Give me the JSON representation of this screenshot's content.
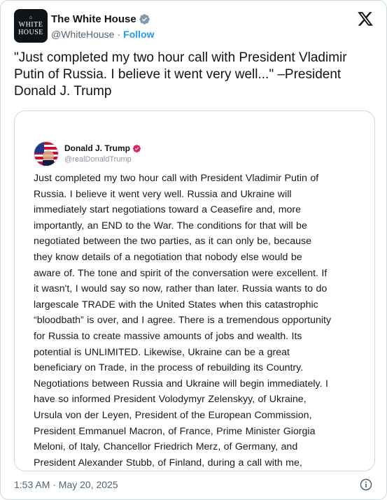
{
  "author": {
    "display_name": "The White House",
    "handle": "@WhiteHouse",
    "separator": "·",
    "follow_label": "Follow",
    "avatar_text_1": "WHITE",
    "avatar_text_2": "HOUSE"
  },
  "post": {
    "text": "\"Just completed my two hour call with President Vladimir Putin of Russia. I believe it went very well...\" –President Donald J. Trump"
  },
  "quoted": {
    "display_name": "Donald J. Trump",
    "handle": "@realDonaldTrump",
    "lines": [
      "Just completed my two hour call with President Vladimir Putin of",
      "Russia. I believe it went very well. Russia and Ukraine will",
      "immediately start negotiations toward a Ceasefire and, more",
      "importantly, an END to the War. The conditions for that will be",
      "negotiated between the two parties, as it can only be, because",
      "they know details of a negotiation that nobody else would be",
      "aware of. The tone and spirit of the conversation were excellent. If",
      "it wasn't, I would say so now, rather than later. Russia wants to do",
      "largescale TRADE with the United States when this catastrophic",
      "“bloodbath” is over, and I agree. There is a tremendous opportunity",
      "for Russia to create massive amounts of jobs and wealth. Its",
      "potential is UNLIMITED. Likewise, Ukraine can be a great",
      "beneficiary on Trade, in the process of rebuilding its Country.",
      "Negotiations between Russia and Ukraine will begin immediately. I",
      "have so informed President Volodymyr Zelenskyy, of Ukraine,",
      "Ursula von der Leyen, President of the European Commission,",
      "President Emmanuel Macron, of France, Prime Minister Giorgia",
      "Meloni, of Italy, Chancellor Friedrich Merz, of Germany, and",
      "President Alexander Stubb, of Finland, during a call with me,"
    ]
  },
  "footer": {
    "timestamp": "1:53 AM · May 20, 2025"
  },
  "icons": {
    "verified": "verified-badge-icon",
    "quoted_verified": "verified-badge-icon",
    "platform_logo": "x-logo-icon",
    "info": "info-icon"
  },
  "colors": {
    "link": "#1d9bf0",
    "secondary_text": "#536471",
    "quoted_badge": "#e0245e",
    "border": "#cfd9de"
  }
}
